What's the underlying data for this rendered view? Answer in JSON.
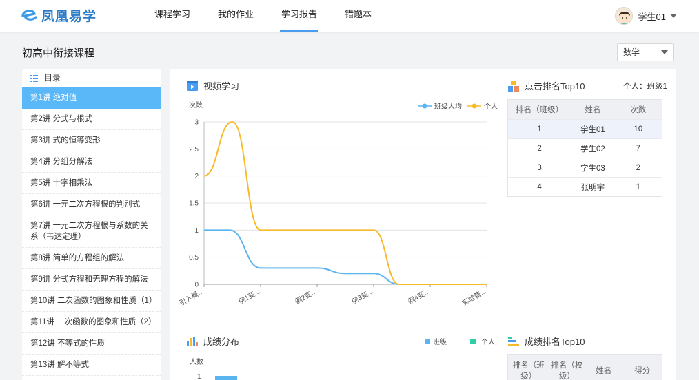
{
  "header": {
    "brand": "凤凰易学",
    "nav": [
      {
        "label": "课程学习",
        "active": false
      },
      {
        "label": "我的作业",
        "active": false
      },
      {
        "label": "学习报告",
        "active": true
      },
      {
        "label": "错题本",
        "active": false
      }
    ],
    "user": {
      "name": "学生01"
    }
  },
  "page": {
    "title": "初高中衔接课程"
  },
  "subject_select": {
    "value": "数学"
  },
  "sidebar": {
    "title": "目录",
    "items": [
      {
        "label": "第1讲 绝对值",
        "active": true
      },
      {
        "label": "第2讲 分式与根式"
      },
      {
        "label": "第3讲 式的恒等变形"
      },
      {
        "label": "第4讲 分组分解法"
      },
      {
        "label": "第5讲 十字相乘法"
      },
      {
        "label": "第6讲 一元二次方程根的判别式"
      },
      {
        "label": "第7讲 一元二次方程根与系数的关系（韦达定理）"
      },
      {
        "label": "第8讲 简单的方程组的解法"
      },
      {
        "label": "第9讲 分式方程和无理方程的解法"
      },
      {
        "label": "第10讲 二次函数的图象和性质（1）"
      },
      {
        "label": "第11讲 二次函数的图象和性质（2）"
      },
      {
        "label": "第12讲 不等式的性质"
      },
      {
        "label": "第13讲 解不等式"
      }
    ]
  },
  "video_section": {
    "title": "视频学习",
    "legend": [
      "班级人均",
      "个人"
    ]
  },
  "chart_data": {
    "type": "line",
    "title": "",
    "ylabel": "次数",
    "xlabel": "",
    "ylim": [
      0,
      3
    ],
    "yticks": [
      "0",
      "0.5",
      "1",
      "1.5",
      "2",
      "2.5",
      "3"
    ],
    "categories": [
      "引入概...",
      "例1变...",
      "例2变...",
      "例3变...",
      "例4变...",
      "实验籍..."
    ],
    "x_fractions_note": "",
    "series": [
      {
        "name": "班级人均",
        "color": "#5ab4f0",
        "points": [
          [
            0,
            1
          ],
          [
            0.45,
            1
          ],
          [
            1,
            0.3
          ],
          [
            1.5,
            0.3
          ],
          [
            2,
            0.3
          ],
          [
            2.5,
            0.2
          ],
          [
            3,
            0.2
          ],
          [
            3.45,
            0
          ],
          [
            4,
            0
          ],
          [
            5,
            0
          ]
        ]
      },
      {
        "name": "个人",
        "color": "#f7bb2a",
        "points": [
          [
            0,
            2
          ],
          [
            0.5,
            3
          ],
          [
            1,
            1
          ],
          [
            1.5,
            1
          ],
          [
            2,
            1
          ],
          [
            2.5,
            1
          ],
          [
            3,
            1
          ],
          [
            3.45,
            0
          ],
          [
            4,
            0
          ],
          [
            5,
            0
          ]
        ]
      }
    ],
    "grid": true,
    "legend_position": "top-right"
  },
  "click_rank": {
    "title": "点击排名Top10",
    "note": "个人：班级1",
    "headers": [
      "排名（班级）",
      "姓名",
      "次数"
    ],
    "rows": [
      [
        "1",
        "学生01",
        "10"
      ],
      [
        "2",
        "学生02",
        "7"
      ],
      [
        "3",
        "学生03",
        "2"
      ],
      [
        "4",
        "张明宇",
        "1"
      ]
    ]
  },
  "score_section": {
    "title": "成绩分布",
    "legend": [
      "班级",
      "个人"
    ],
    "ylabel": "人数",
    "first_tick": "1"
  },
  "score_rank": {
    "title": "成绩排名Top10",
    "headers": [
      "排名（班级）",
      "排名（校级）",
      "姓名",
      "得分"
    ]
  },
  "colors": {
    "accent": "#4a9cf0",
    "active_item": "#5bb8f8",
    "class_avg": "#5ab4f0",
    "personal": "#f7bb2a",
    "score_personal": "#2ecfa7"
  }
}
